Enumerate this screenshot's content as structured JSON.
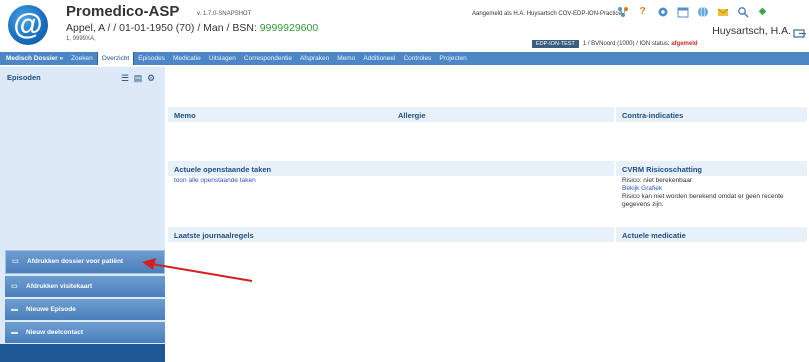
{
  "header": {
    "app_title": "Promedico-ASP",
    "version": "v. 1.7.0-SNAPSHOT",
    "patient_prefix": "Appel, A / / 01-01-1950 (70) / Man / BSN: ",
    "patient_bsn": "9999929600",
    "patient_sub": "1, 9999XA,",
    "logged_in_as": "Aangemeld als H.A. Huysartsch  COV-EDP-ION-Practice",
    "practitioner": "Huysartsch, H.A.",
    "badge": "EDP-ION-TEST",
    "status_prefix": "1 / BVNoord (1000) / ION status: ",
    "status_value": "afgemeld",
    "icons": [
      "network-icon",
      "help-icon",
      "settings-icon",
      "calendar-icon",
      "globe-icon",
      "mail-icon",
      "search-icon",
      "plugin-icon"
    ]
  },
  "nav": {
    "items": [
      {
        "label": "Medisch Dossier »",
        "strong": true
      },
      {
        "label": "Zoeken"
      },
      {
        "label": "Overzicht",
        "active": true
      },
      {
        "label": "Episodes"
      },
      {
        "label": "Medicatie"
      },
      {
        "label": "Uitslagen"
      },
      {
        "label": "Correspondentie"
      },
      {
        "label": "Afspraken"
      },
      {
        "label": "Memo"
      },
      {
        "label": "Additioneel"
      },
      {
        "label": "Controles"
      },
      {
        "label": "Projecten"
      }
    ]
  },
  "sidebar": {
    "title": "Episoden",
    "actions": [
      {
        "label": "Afdrukken dossier voor patiënt"
      },
      {
        "label": "Afdrukken visitekaart"
      },
      {
        "label": "Nieuwe Episode"
      },
      {
        "label": "Nieuw deelcontact"
      }
    ]
  },
  "main": {
    "memo_title": "Memo",
    "allergie_title": "Allergie",
    "contra_title": "Contra-indicaties",
    "taken_title": "Actuele openstaande taken",
    "taken_link": "toon alle openstaande taken",
    "cvrm_title": "CVRM Risicoschatting",
    "cvrm_risk": "Risico:  niet berekenbaar",
    "cvrm_link": "Bekijk Grafiek",
    "cvrm_note": "Risico kan niet worden berekend omdat er geen recente gegevens zijn.",
    "journaal_title": "Laatste journaalregels",
    "medicatie_title": "Actuele medicatie"
  },
  "colors": {
    "nav_bg": "#4c86c4",
    "sidebar_bg": "#dde9f6",
    "accent": "#1d4f86",
    "link": "#2a55c8",
    "alert": "#d22a2a",
    "bsn": "#2e9d34",
    "arrow": "#d42020"
  }
}
